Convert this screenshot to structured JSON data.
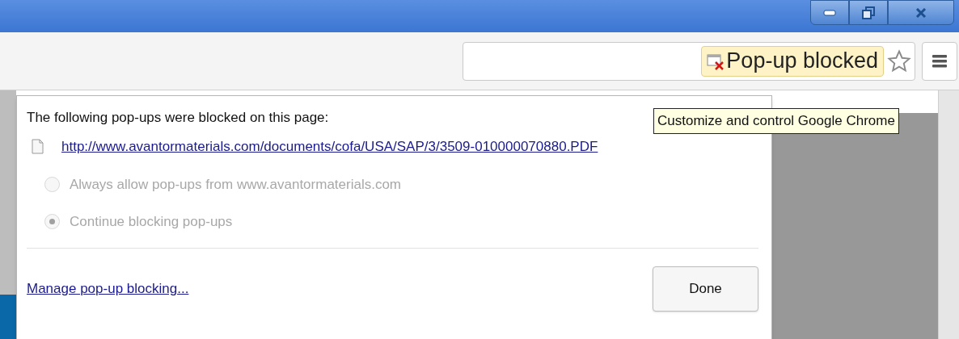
{
  "window_controls": [
    {
      "kind": "minimize"
    },
    {
      "kind": "restore"
    },
    {
      "kind": "close"
    }
  ],
  "toolbar": {
    "popup_indicator": "Pop-up blocked",
    "bookmarked": false
  },
  "tooltip": "Customize and control Google Chrome",
  "bubble": {
    "heading": "The following pop-ups were blocked on this page:",
    "blocked_links": [
      "http://www.avantormaterials.com/documents/cofa/USA/SAP/3/3509-010000070880.PDF"
    ],
    "options": [
      {
        "label": "Always allow pop-ups from www.avantormaterials.com",
        "selected": false,
        "disabled": true
      },
      {
        "label": "Continue blocking pop-ups",
        "selected": true,
        "disabled": true
      }
    ],
    "manage_link": "Manage pop-up blocking...",
    "done_button": "Done"
  }
}
